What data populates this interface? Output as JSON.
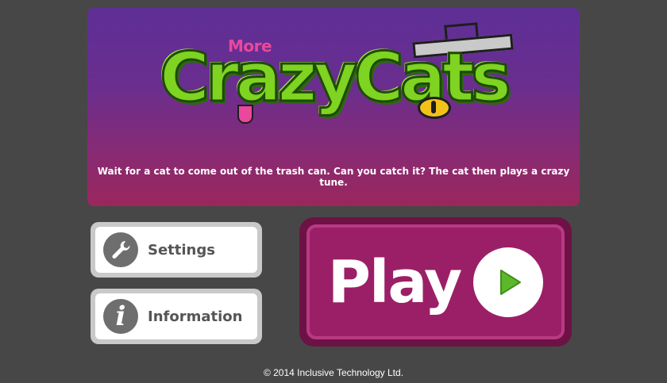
{
  "banner": {
    "logo_prefix": "More",
    "logo_title": "CrazyCats",
    "tagline": "Wait for a cat to come out of the trash can. Can you catch it? The cat then plays a crazy tune."
  },
  "buttons": {
    "settings_label": "Settings",
    "settings_icon": "wrench-icon",
    "information_label": "Information",
    "information_icon": "info-icon",
    "play_label": "Play",
    "play_icon": "play-arrow-icon"
  },
  "footer": {
    "copyright": "© 2014 Inclusive Technology Ltd."
  },
  "colors": {
    "background": "#474747",
    "banner_top": "#5e2f97",
    "banner_bottom": "#9a275d",
    "logo_green": "#7fd321",
    "logo_more_pink": "#e9489c",
    "play_button": "#9b1f66",
    "play_arrow": "#5cb82a",
    "side_icon_grey": "#6e6e6e"
  }
}
